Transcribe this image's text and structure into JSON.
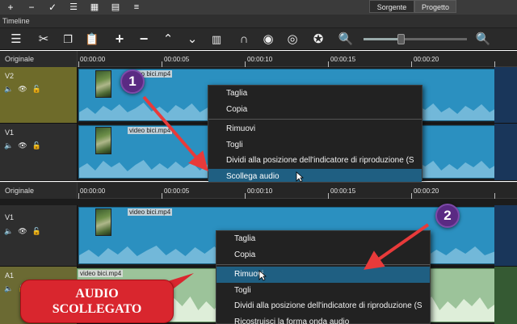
{
  "toolbar_top": {
    "icons": [
      "plus-icon",
      "minus-icon",
      "check-icon",
      "list-icon",
      "grid-icon",
      "detail-icon",
      "menu-icon"
    ],
    "tabs": [
      "Sorgente",
      "Progetto"
    ]
  },
  "timeline": {
    "label": "Timeline",
    "toolbar_icons": [
      "menu-icon",
      "scissors-icon",
      "copy-icon",
      "paste-icon",
      "add-icon",
      "remove-icon",
      "lift-icon",
      "overwrite-icon",
      "split-icon",
      "snap-icon",
      "scrub-icon",
      "ripple-icon",
      "ripple-all-icon",
      "zoom-out-icon",
      "zoom-in-icon"
    ],
    "zoom_level": 0.36
  },
  "panel1": {
    "header": "Originale",
    "timecodes": [
      "00:00:00",
      "00:00:05",
      "00:00:10",
      "00:00:15",
      "00:00:20"
    ],
    "tracks": [
      {
        "name": "V2",
        "clip": "video bici.mp4"
      },
      {
        "name": "V1",
        "clip": "video bici.mp4"
      }
    ],
    "menu": [
      "Taglia",
      "Copia",
      "Rimuovi",
      "Togli",
      "Dividi alla posizione dell'indicatore di riproduzione (S",
      "Scollega audio"
    ],
    "highlight": "Scollega audio"
  },
  "panel2": {
    "header": "Originale",
    "timecodes": [
      "00:00:00",
      "00:00:05",
      "00:00:10",
      "00:00:15",
      "00:00:20"
    ],
    "tracks": [
      {
        "name": "V1",
        "clip": "video bici.mp4"
      },
      {
        "name": "A1",
        "clip": "video bici.mp4"
      }
    ],
    "menu": [
      "Taglia",
      "Copia",
      "Rimuovi",
      "Togli",
      "Dividi alla posizione dell'indicatore di riproduzione (S",
      "Ricostruisci la forma onda audio"
    ],
    "highlight": "Rimuovi"
  },
  "annotations": {
    "badge1": "1",
    "badge2": "2",
    "callout_line1": "AUDIO",
    "callout_line2": "SCOLLEGATO",
    "badge_color": "#5a2a83",
    "callout_color": "#d9262e",
    "arrow_color": "#e83a3a"
  }
}
